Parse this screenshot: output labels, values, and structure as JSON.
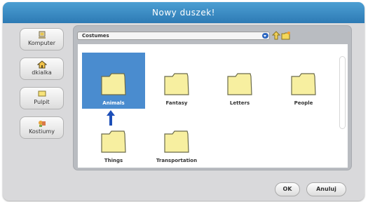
{
  "dialog": {
    "title": "Nowy duszek!"
  },
  "sidebar": {
    "items": [
      {
        "label": "Komputer",
        "icon": "computer-icon"
      },
      {
        "label": "dkialka",
        "icon": "home-icon"
      },
      {
        "label": "Pulpit",
        "icon": "desktop-icon"
      },
      {
        "label": "Kostiumy",
        "icon": "costumes-icon"
      }
    ]
  },
  "path": {
    "current": "Costumes"
  },
  "folders": [
    {
      "label": "Animals",
      "selected": true
    },
    {
      "label": "Fantasy",
      "selected": false
    },
    {
      "label": "Letters",
      "selected": false
    },
    {
      "label": "People",
      "selected": false
    },
    {
      "label": "Things",
      "selected": false
    },
    {
      "label": "Transportation",
      "selected": false
    }
  ],
  "buttons": {
    "ok": "OK",
    "cancel": "Anuluj"
  },
  "colors": {
    "titlebar": "#3a8bc6",
    "selection": "#4a8ccf",
    "folder": "#f7efa0",
    "arrow": "#1d4fb8"
  }
}
